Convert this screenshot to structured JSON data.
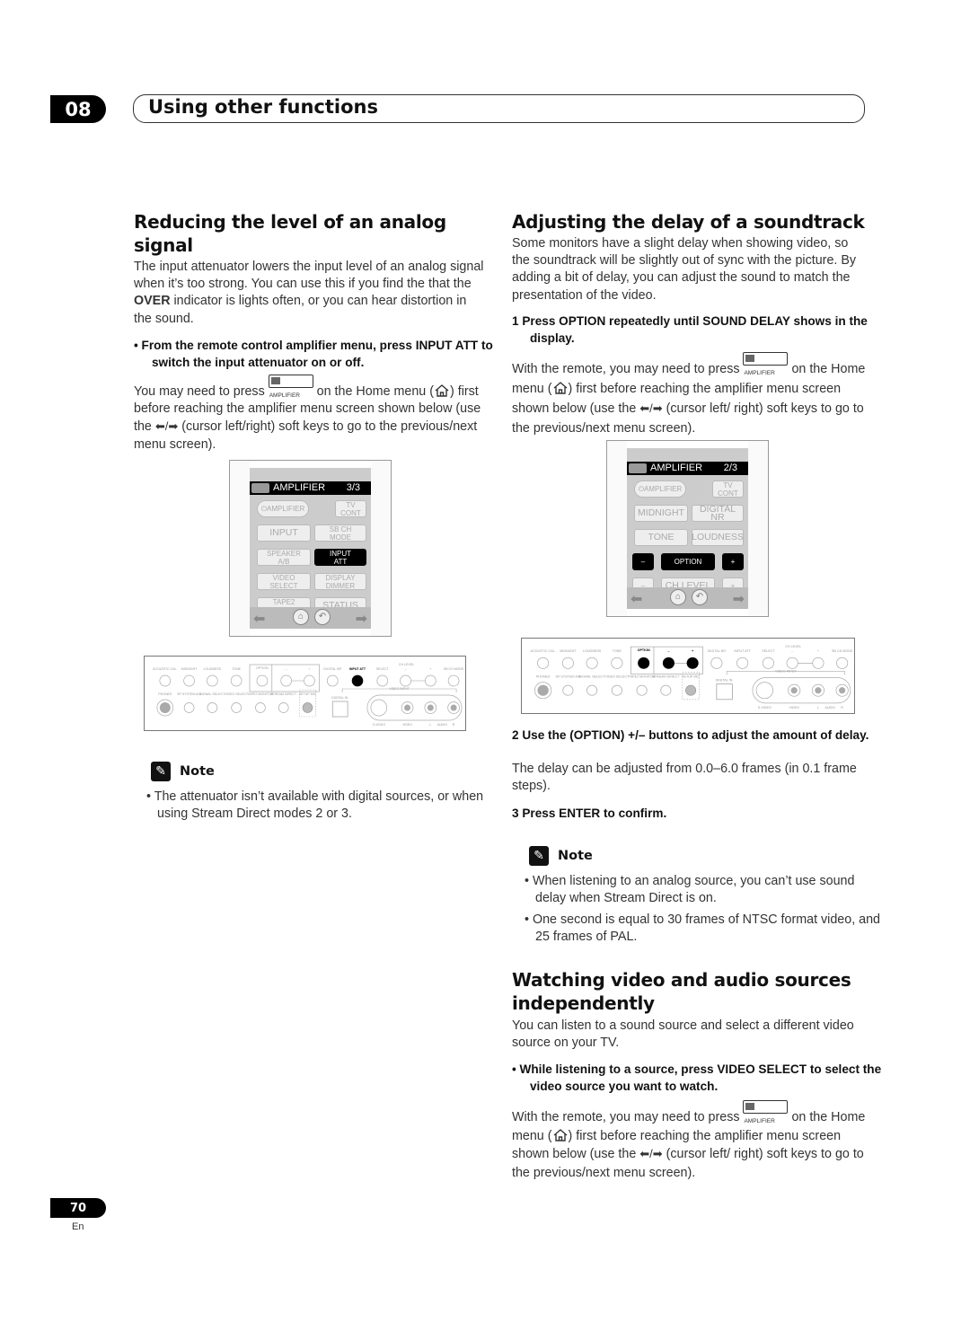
{
  "header": {
    "chapter": "08",
    "title": "Using other functions"
  },
  "left": {
    "heading": "Reducing the level of an analog signal",
    "intro": [
      {
        "t": "The input attenuator lowers the input level of an analog signal when it’s too strong. You can use this if you find the that the "
      },
      {
        "b": "OVER"
      },
      {
        "t": " indicator is lights often, or you can hear distortion in the sound."
      }
    ],
    "step": "•   From the remote control amplifier menu, press INPUT ATT to switch the input attenuator on or off.",
    "instruction": [
      {
        "t": "You may need to press "
      },
      {
        "i": "amp"
      },
      {
        "t": " on the Home menu ("
      },
      {
        "i": "home"
      },
      {
        "t": ") first before reaching the amplifier menu screen shown below (use the "
      },
      {
        "i": "arrows"
      },
      {
        "t": " (cursor left/right) soft keys to go to the previous/next menu screen)."
      }
    ],
    "note_title": "Note",
    "notes": [
      "The attenuator isn’t available with digital sources, or when using Stream Direct modes 2 or 3."
    ]
  },
  "right": {
    "heading": "Adjusting the delay of a soundtrack",
    "intro": "Some monitors have a slight delay when showing video, so the soundtrack will be slightly out of sync with the picture. By adding a bit of delay, you can adjust the sound to match the presentation of the video.",
    "step1": "1   Press OPTION repeatedly until SOUND DELAY shows in the display.",
    "instruction": [
      {
        "t": "With the remote, you may need to press "
      },
      {
        "i": "amp"
      },
      {
        "t": " on the Home menu ("
      },
      {
        "i": "home"
      },
      {
        "t": ") first before reaching the amplifier menu screen shown below (use the "
      },
      {
        "i": "arrows"
      },
      {
        "t": " (cursor left/ right) soft keys to go to the previous/next menu screen)."
      }
    ],
    "step2": "2   Use the (OPTION) +/– buttons to adjust the amount of delay.",
    "step2_text": "The delay can be adjusted from 0.0–6.0 frames (in 0.1 frame steps).",
    "step3": "3   Press ENTER to confirm.",
    "note_title": "Note",
    "notes": [
      "When listening to an analog source, you can’t use sound delay when Stream Direct is on.",
      "One second is equal to 30 frames of NTSC format video, and 25 frames of PAL."
    ],
    "heading2": "Watching video and audio sources independently",
    "intro2": "You can listen to a sound source and select a different video source on your TV.",
    "step4": "•   While listening to a source, press VIDEO SELECT to select the video source you want to watch.",
    "instruction2": [
      {
        "t": "With the remote, you may need to press "
      },
      {
        "i": "amp"
      },
      {
        "t": " on the Home menu ("
      },
      {
        "i": "home"
      },
      {
        "t": ") first before reaching the amplifier menu screen shown below (use the "
      },
      {
        "i": "arrows"
      },
      {
        "t": " (cursor left/ right) soft keys to go to the previous/next menu screen)."
      }
    ]
  },
  "icons": {
    "amp_label": "AMPLIFIER",
    "arrows": "⬅/➡",
    "home": "home-icon"
  },
  "remote_left": {
    "title": "AMPLIFIER",
    "page": "3/3",
    "buttons": [
      {
        "label": "⏻AMPLIFIER",
        "style": "pill"
      },
      {
        "label": "TV\nCONT"
      },
      {
        "label": "INPUT",
        "style": "big"
      },
      {
        "label": "SB CH\nMODE"
      },
      {
        "label": "SPEAKER\nA/B"
      },
      {
        "label": "INPUT\nATT",
        "style": "on"
      },
      {
        "label": "VIDEO\nSELECT"
      },
      {
        "label": "DISPLAY\nDIMMER"
      },
      {
        "label": "TAPE2\nMONITOR"
      },
      {
        "label": "STATUS",
        "style": "big"
      }
    ]
  },
  "remote_right": {
    "title": "AMPLIFIER",
    "page": "2/3",
    "buttons": [
      {
        "label": "⏻AMPLIFIER",
        "style": "pill"
      },
      {
        "label": "TV\nCONT"
      },
      {
        "label": "MIDNIGHT",
        "style": "big"
      },
      {
        "label": "DIGITAL NR",
        "style": "big"
      },
      {
        "label": "TONE",
        "style": "big"
      },
      {
        "label": "LOUDNESS",
        "style": "big"
      },
      {
        "label": "–",
        "style": "on"
      },
      {
        "label": "OPTION",
        "style": "on"
      },
      {
        "label": "+",
        "style": "on"
      },
      {
        "label": "–"
      },
      {
        "label": "CH LEVEL",
        "style": "big"
      },
      {
        "label": "+"
      }
    ]
  },
  "front_panel": {
    "top_labels": [
      "ACOUSTIC CAL.",
      "MIDNIGHT",
      "LOUDNESS",
      "TONE",
      "OPTION",
      "–",
      "+",
      "DIGITAL NR",
      "INPUT ATT",
      "SELECT",
      "–",
      "+",
      "SB CH MODE"
    ],
    "ch_level_label": "CH LEVEL",
    "bottom_labels": [
      "PHONES",
      "SP SYSTEM A/B",
      "SIGNAL SELECT",
      "VIDEO SELECT",
      "TAPE2 MONITOR",
      "STREAM DIRECT",
      "SETUP MIC",
      "DIGITAL IN"
    ],
    "video_input_label": "VIDEO INPUT",
    "jack_labels": [
      "S-VIDEO",
      "VIDEO",
      "L",
      "AUDIO",
      "R"
    ],
    "highlight_left": [
      "INPUT ATT"
    ],
    "highlight_right": [
      "OPTION",
      "–",
      "+"
    ]
  },
  "footer": {
    "page": "70",
    "lang": "En"
  }
}
